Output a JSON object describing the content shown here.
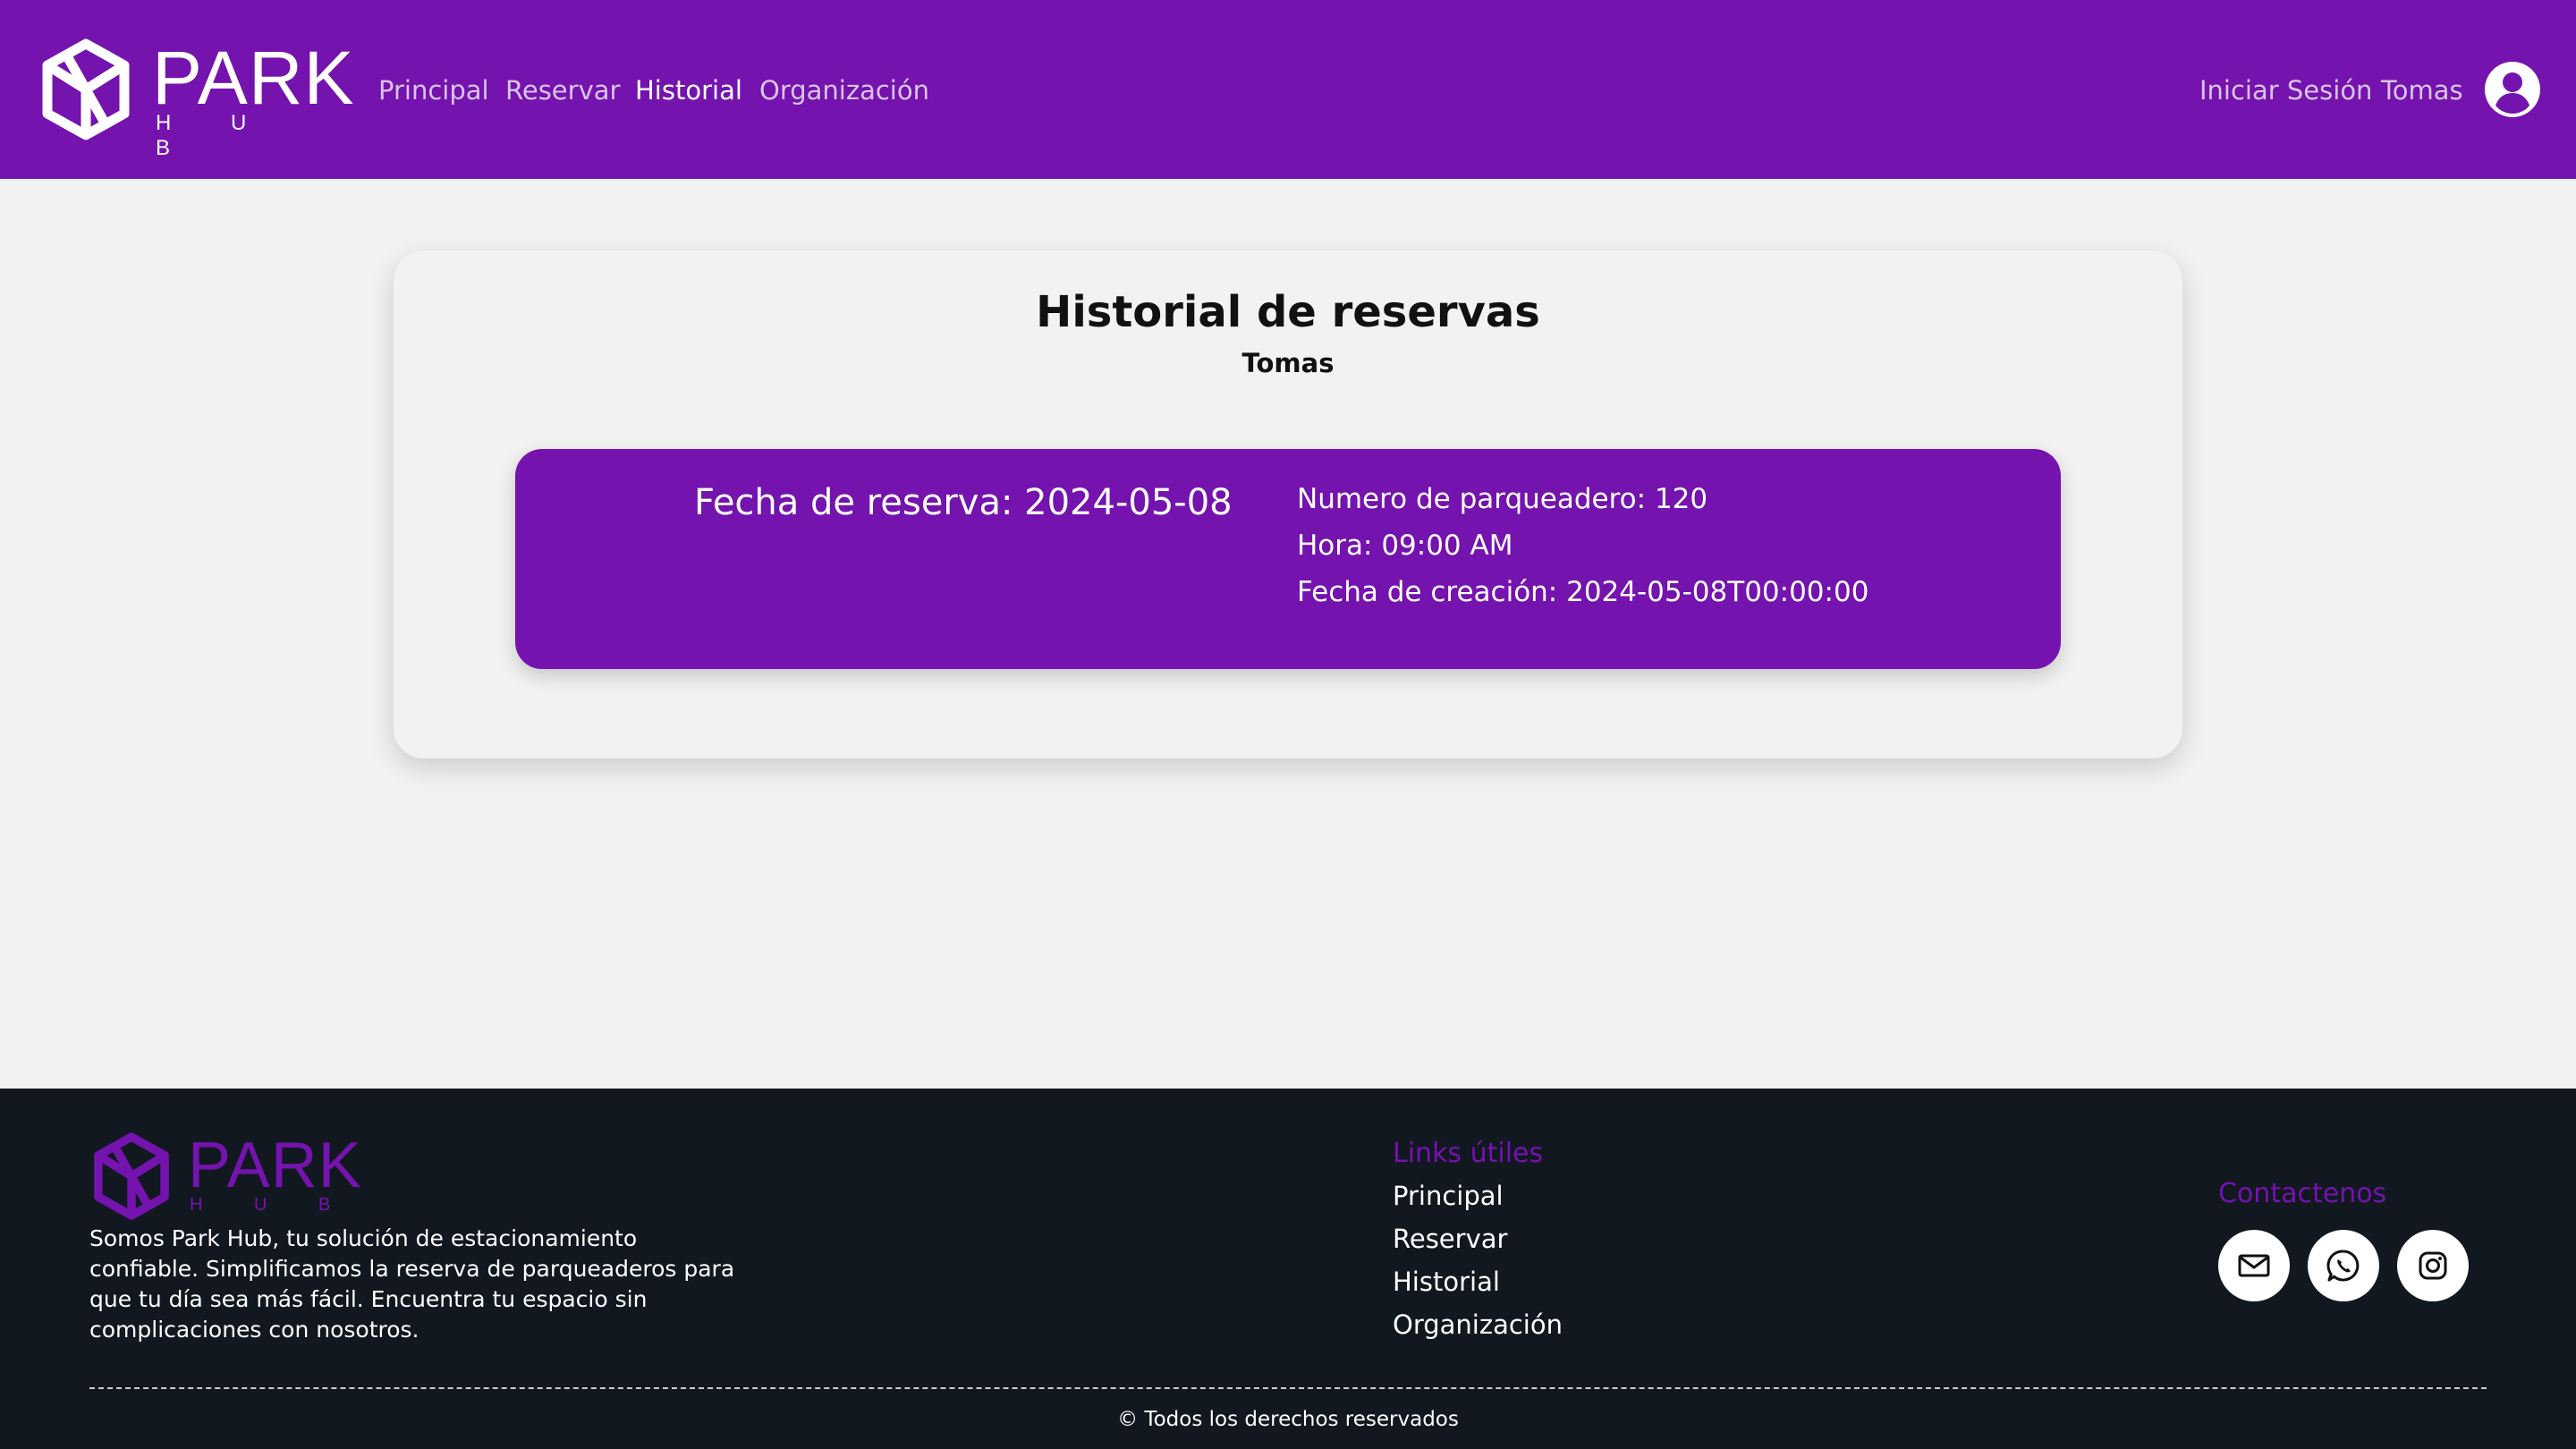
{
  "header": {
    "logo": {
      "park": "PARK",
      "hub": "H U B"
    },
    "nav": [
      {
        "label": "Principal",
        "active": false
      },
      {
        "label": "Reservar",
        "active": false
      },
      {
        "label": "Historial",
        "active": true
      },
      {
        "label": "Organización",
        "active": false
      }
    ],
    "login_label": "Iniciar Sesión",
    "user_name": "Tomas",
    "user_icon": "account-circle-icon"
  },
  "main": {
    "title": "Historial de reservas",
    "subtitle": "Tomas",
    "reservations": [
      {
        "date_text": "Fecha de reserva: 2024-05-08",
        "parking_number_text": "Numero de parqueadero: 120",
        "time_text": "Hora: 09:00 AM",
        "created_text": "Fecha de creación: 2024-05-08T00:00:00"
      }
    ]
  },
  "footer": {
    "logo": {
      "park": "PARK",
      "hub": "H U B"
    },
    "about": "Somos Park Hub, tu solución de estacionamiento confiable. Simplificamos la reserva de parqueaderos para que tu día sea más fácil. Encuentra tu espacio sin complicaciones con nosotros.",
    "links_title": "Links útiles",
    "links": [
      "Principal",
      "Reservar",
      "Historial",
      "Organización"
    ],
    "contact_title": "Contactenos",
    "social": [
      {
        "icon": "mail-icon"
      },
      {
        "icon": "whatsapp-icon"
      },
      {
        "icon": "instagram-icon"
      }
    ],
    "copyright": "© Todos los derechos reservados"
  },
  "colors": {
    "brand_purple": "#7413ae",
    "page_background": "#f2f2f2",
    "footer_background": "#121820"
  }
}
